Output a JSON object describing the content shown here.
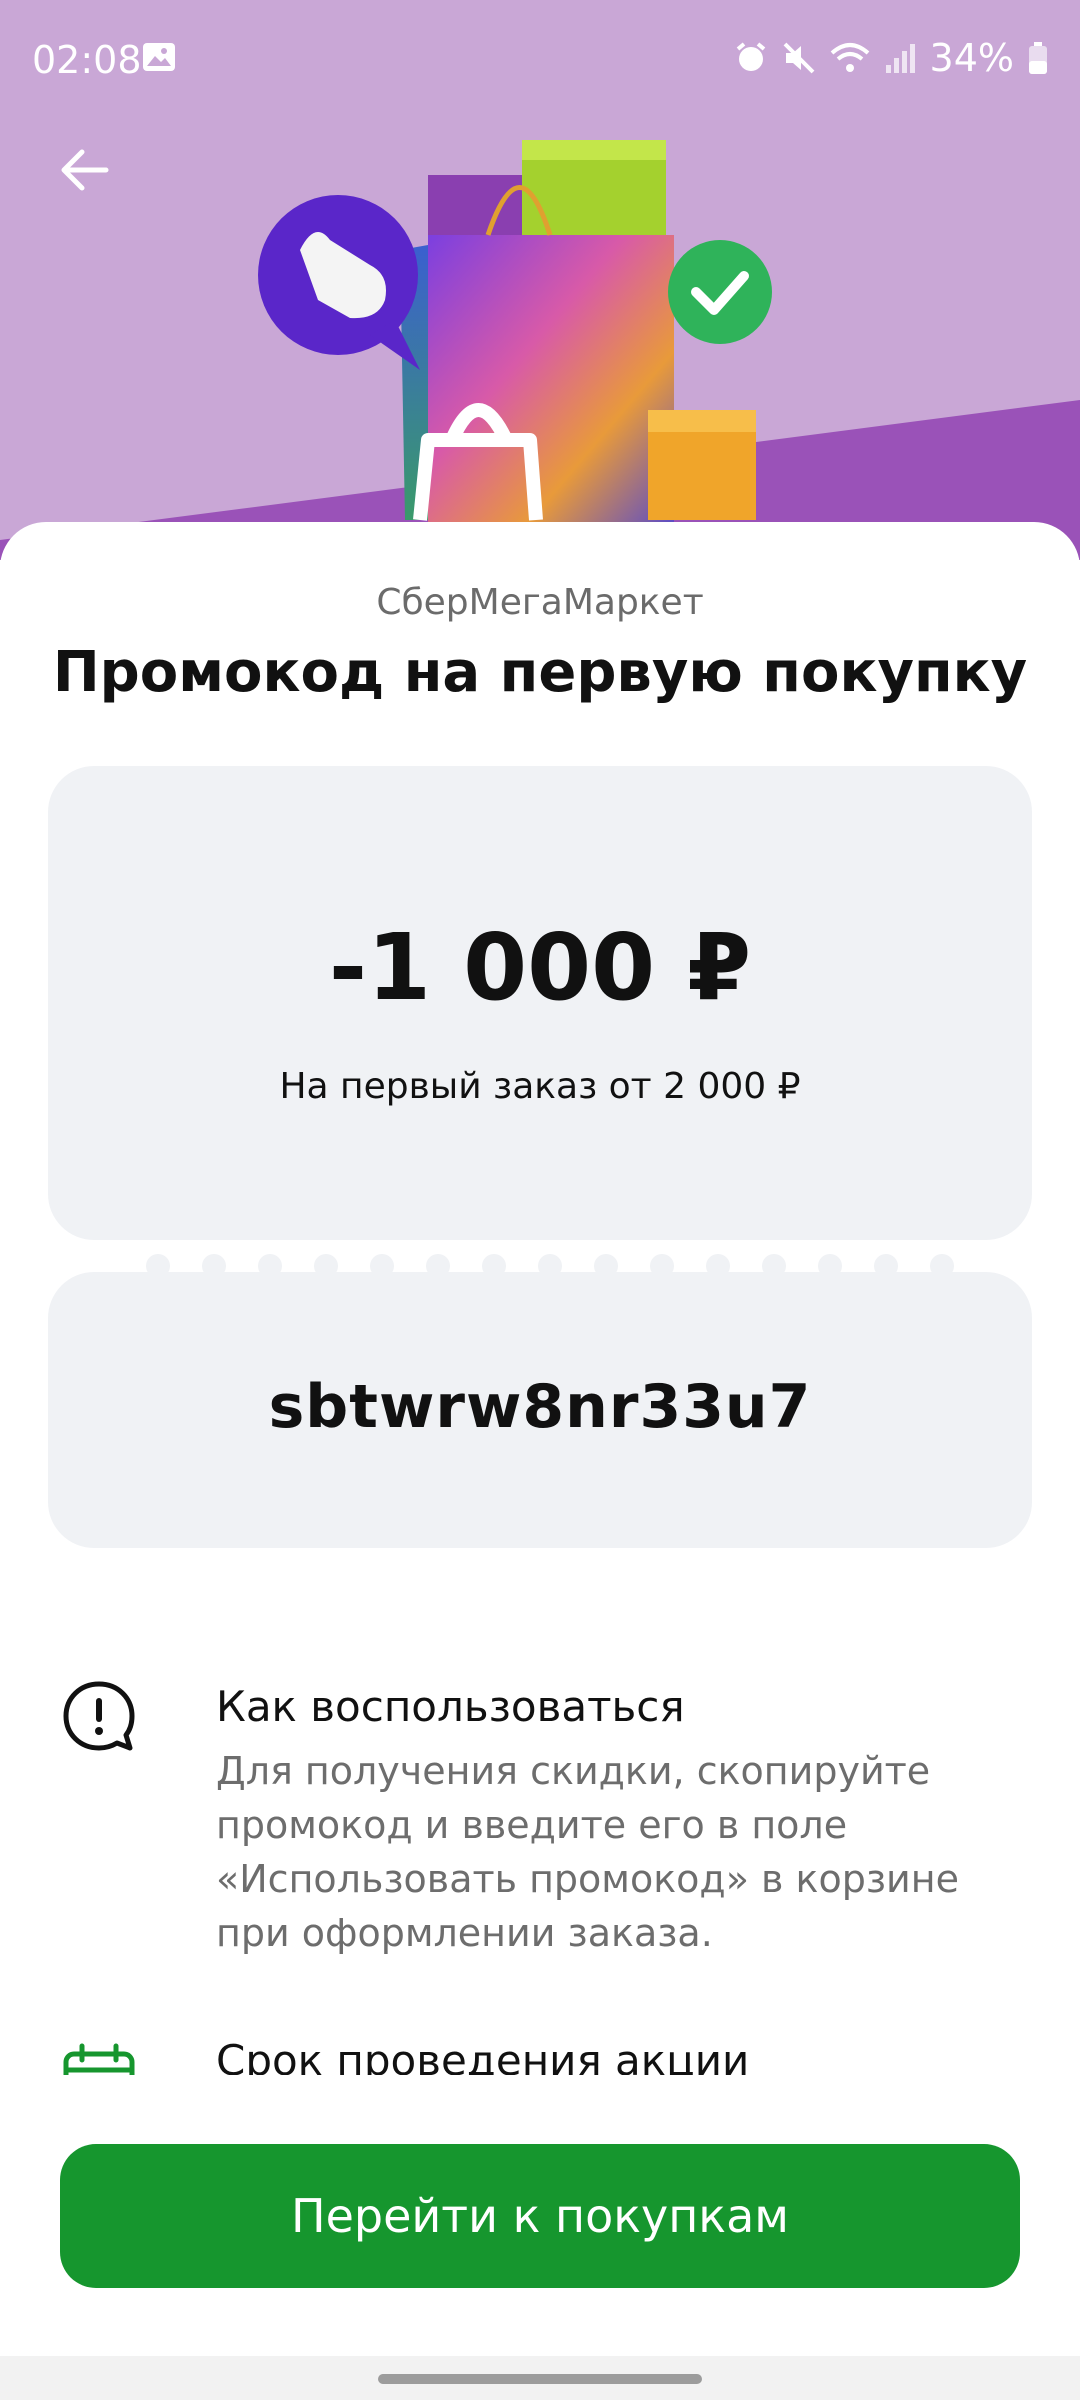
{
  "status_bar": {
    "time": "02:08",
    "battery": "34%",
    "icons": [
      "gallery-icon",
      "alarm-icon",
      "mute-icon",
      "wifi-icon",
      "signal-icon",
      "battery-icon"
    ]
  },
  "header": {
    "back_icon": "arrow-left-icon",
    "hero_image": "shopping-bags-illustration"
  },
  "promo": {
    "brand": "СберМегаМаркет",
    "title": "Промокод на первую покупку",
    "amount": "-1 000 ₽",
    "condition": "На первый заказ от 2 000 ₽",
    "code": "sbtwrw8nr33u7"
  },
  "info": [
    {
      "icon": "speech-bubble-exclamation-icon",
      "title": "Как воспользоваться",
      "text": "Для получения скидки, скопируйте промокод и введите его в поле «Использовать промокод» в корзине при оформлении заказа."
    },
    {
      "icon": "calendar-icon",
      "title": "Срок проведения акции"
    }
  ],
  "cta": {
    "label": "Перейти к покупкам"
  },
  "colors": {
    "accent_green": "#16962e",
    "hero_lilac": "#c9a7d6",
    "hero_purple": "#9a52b8",
    "card_bg": "#f0f2f5"
  }
}
